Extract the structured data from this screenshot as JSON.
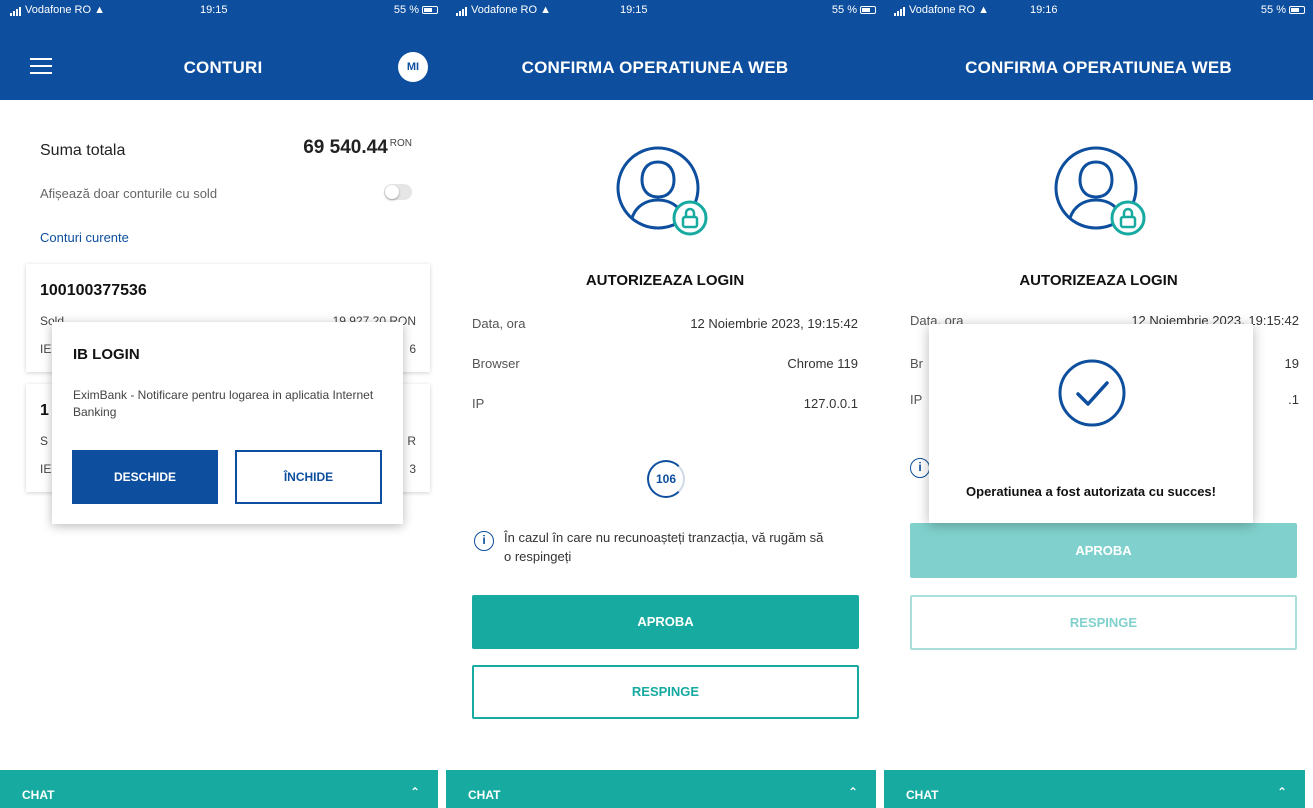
{
  "screens": [
    {
      "status": {
        "carrier": "Vodafone RO",
        "time": "19:15",
        "battery": "55 %"
      },
      "appbar": {
        "title": "CONTURI",
        "avatar": "MI",
        "menu_icon": "hamburger-menu-icon"
      },
      "summary": {
        "label": "Suma totala",
        "value": "69 540.44",
        "currency": "RON"
      },
      "filter_toggle": {
        "label": "Afișează doar conturile cu sold",
        "enabled": false
      },
      "section_title": "Conturi curente",
      "accounts": [
        {
          "number": "100100377536",
          "sold_label": "Sold",
          "sold_value": "19 927.20 RON",
          "iban_label": "IE",
          "iban_tail": "6"
        },
        {
          "number": "1",
          "sold_label": "S",
          "sold_value": "R",
          "iban_label": "IE",
          "iban_tail": "3"
        }
      ],
      "dialog": {
        "title": "IB LOGIN",
        "message": "EximBank - Notificare pentru logarea in aplicatia Internet Banking",
        "primary": "DESCHIDE",
        "secondary": "ÎNCHIDE"
      },
      "chat": {
        "label": "CHAT"
      }
    },
    {
      "status": {
        "carrier": "Vodafone RO",
        "time": "19:15",
        "battery": "55 %"
      },
      "appbar": {
        "title": "CONFIRMA OPERATIUNEA WEB"
      },
      "heading": "AUTORIZEAZA LOGIN",
      "details": [
        {
          "label": "Data, ora",
          "value": "12 Noiembrie 2023, 19:15:42"
        },
        {
          "label": "Browser",
          "value": "Chrome 119"
        },
        {
          "label": "IP",
          "value": "127.0.0.1"
        }
      ],
      "countdown": "106",
      "info": "În cazul în care nu recunoașteți tranzacția, vă rugăm să o respingeți",
      "approve": "APROBA",
      "reject": "RESPINGE",
      "chat": {
        "label": "CHAT"
      }
    },
    {
      "status": {
        "carrier": "Vodafone RO",
        "time": "19:16",
        "battery": "55 %"
      },
      "appbar": {
        "title": "CONFIRMA OPERATIUNEA WEB"
      },
      "heading": "AUTORIZEAZA LOGIN",
      "details_visible": [
        {
          "label": "Data, ora",
          "value": "12 Noiembrie 2023, 19:15:42"
        },
        {
          "label": "Br",
          "value": "19"
        },
        {
          "label": "IP",
          "value": ".1"
        }
      ],
      "success_message": "Operatiunea a fost autorizata cu succes!",
      "approve": "APROBA",
      "reject": "RESPINGE",
      "chat": {
        "label": "CHAT"
      }
    }
  ],
  "colors": {
    "brand_blue": "#0d4f9e",
    "teal": "#17aaa1",
    "teal_disabled": "#80d1cd"
  }
}
